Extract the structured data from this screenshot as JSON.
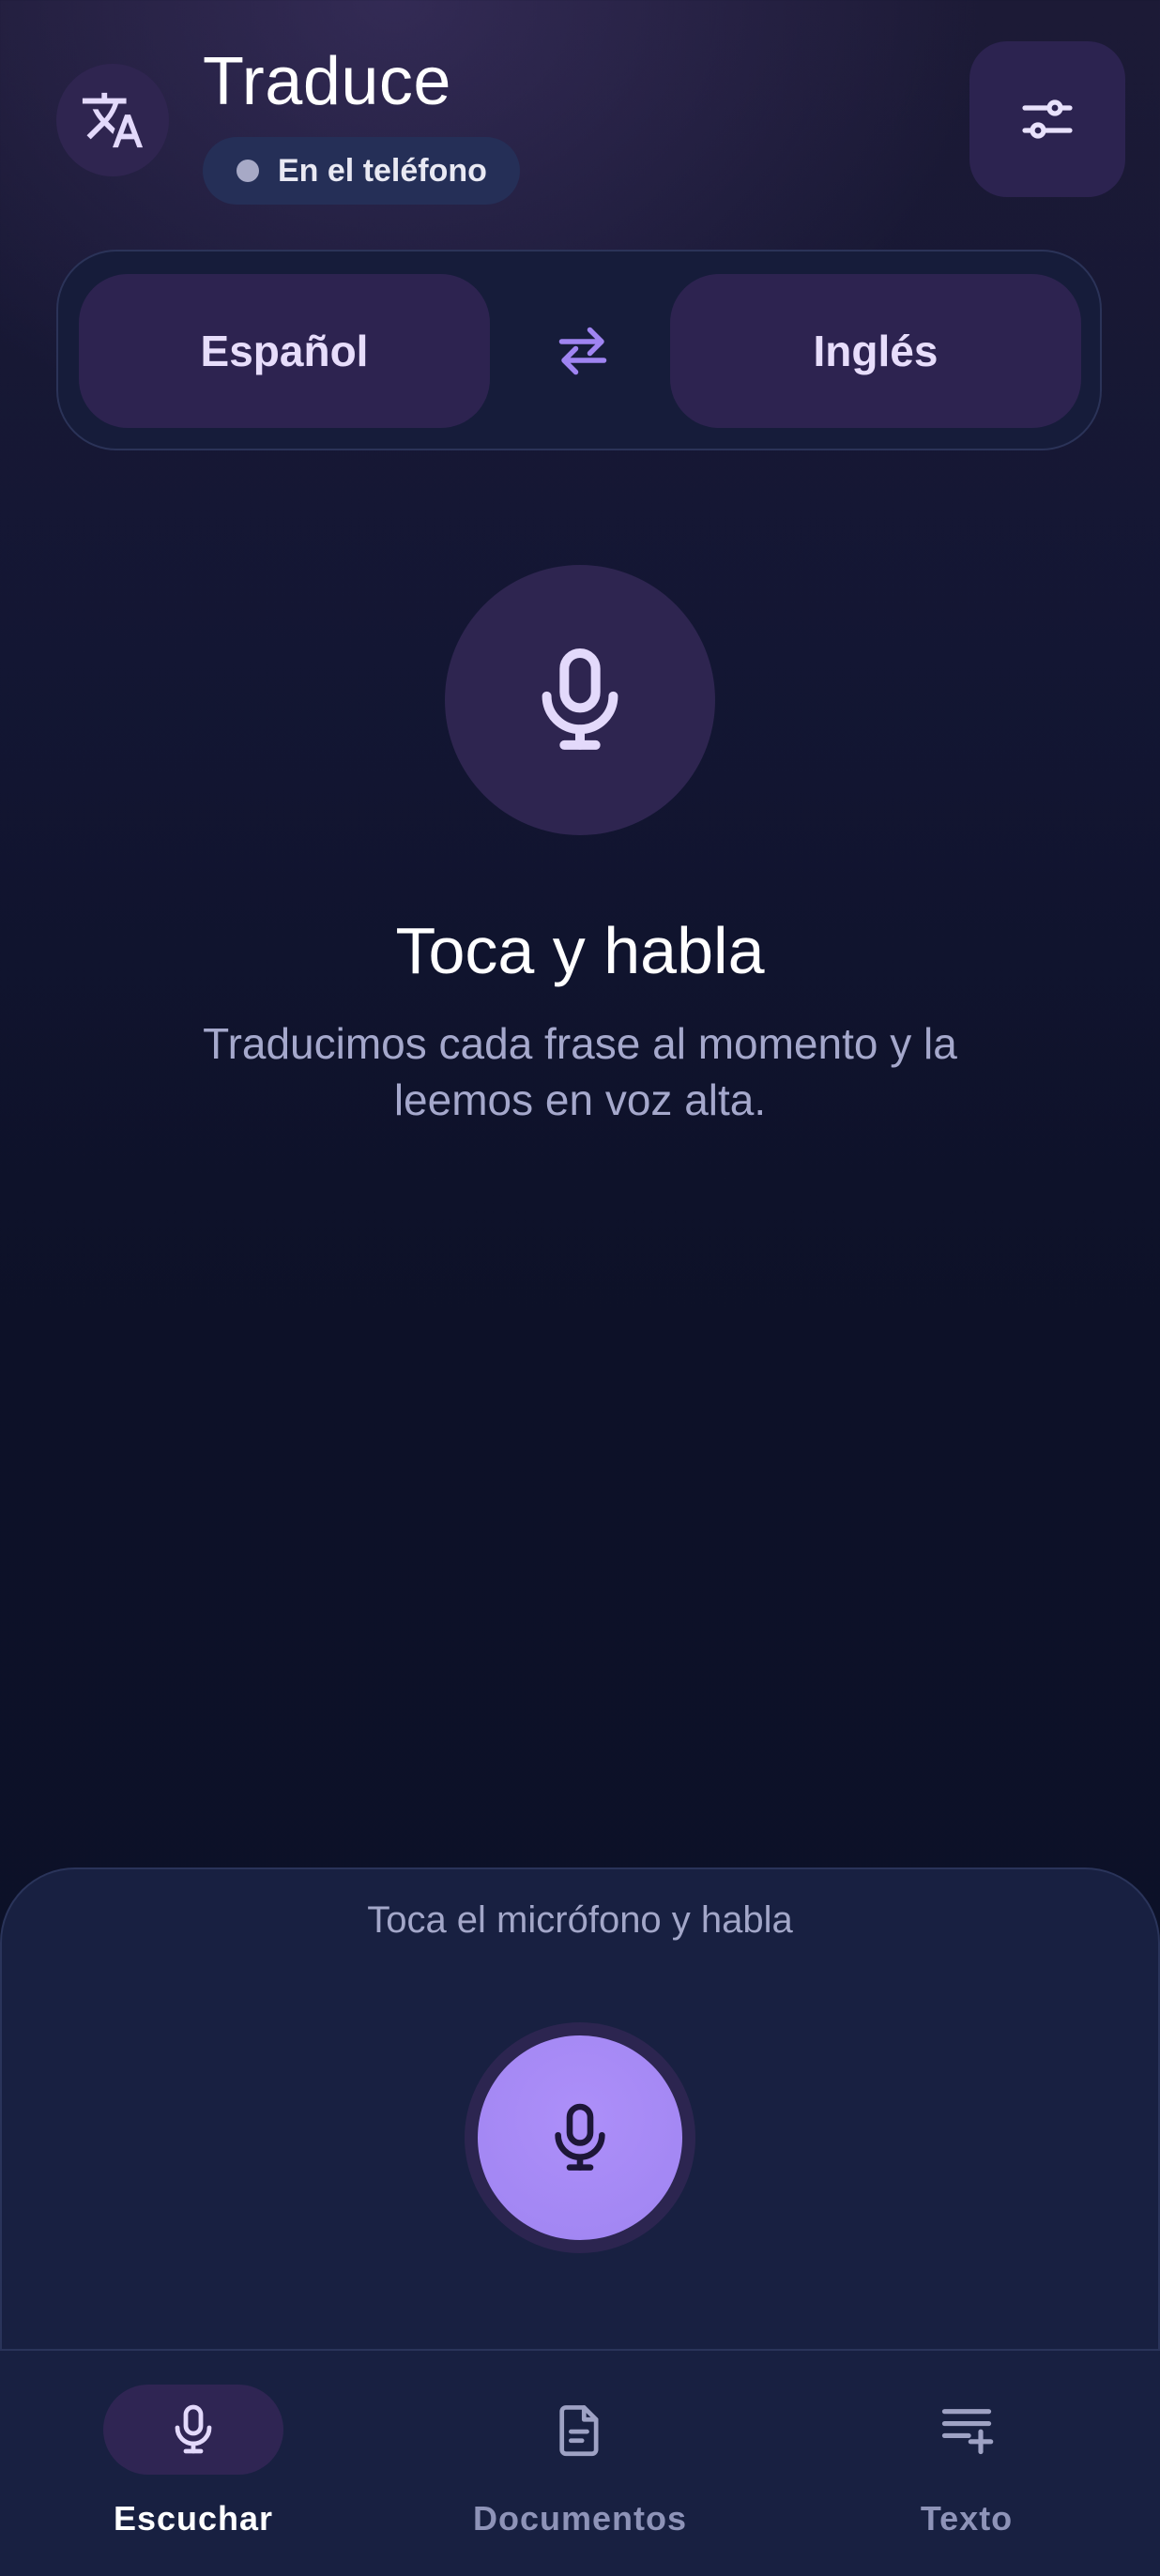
{
  "header": {
    "app_icon": "translate-icon",
    "title": "Traduce",
    "status": {
      "label": "En el teléfono",
      "dot_color": "#a7a9c6"
    },
    "settings_icon": "sliders-icon"
  },
  "languages": {
    "source": "Español",
    "target": "Inglés",
    "swap_icon": "swap-arrows-icon"
  },
  "hero": {
    "icon": "microphone-icon",
    "title": "Toca y habla",
    "description": "Traducimos cada frase al momento y la leemos en voz alta."
  },
  "panel": {
    "hint": "Toca el micrófono y habla",
    "record_icon": "microphone-icon",
    "accent_color": "#a78bfa"
  },
  "nav": {
    "items": [
      {
        "label": "Escuchar",
        "icon": "microphone-icon",
        "active": true
      },
      {
        "label": "Documentos",
        "icon": "document-icon",
        "active": false
      },
      {
        "label": "Texto",
        "icon": "text-add-icon",
        "active": false
      }
    ]
  },
  "colors": {
    "background": "#0d1128",
    "surface": "#182041",
    "chip": "#2d2350",
    "accent": "#a78bfa"
  }
}
